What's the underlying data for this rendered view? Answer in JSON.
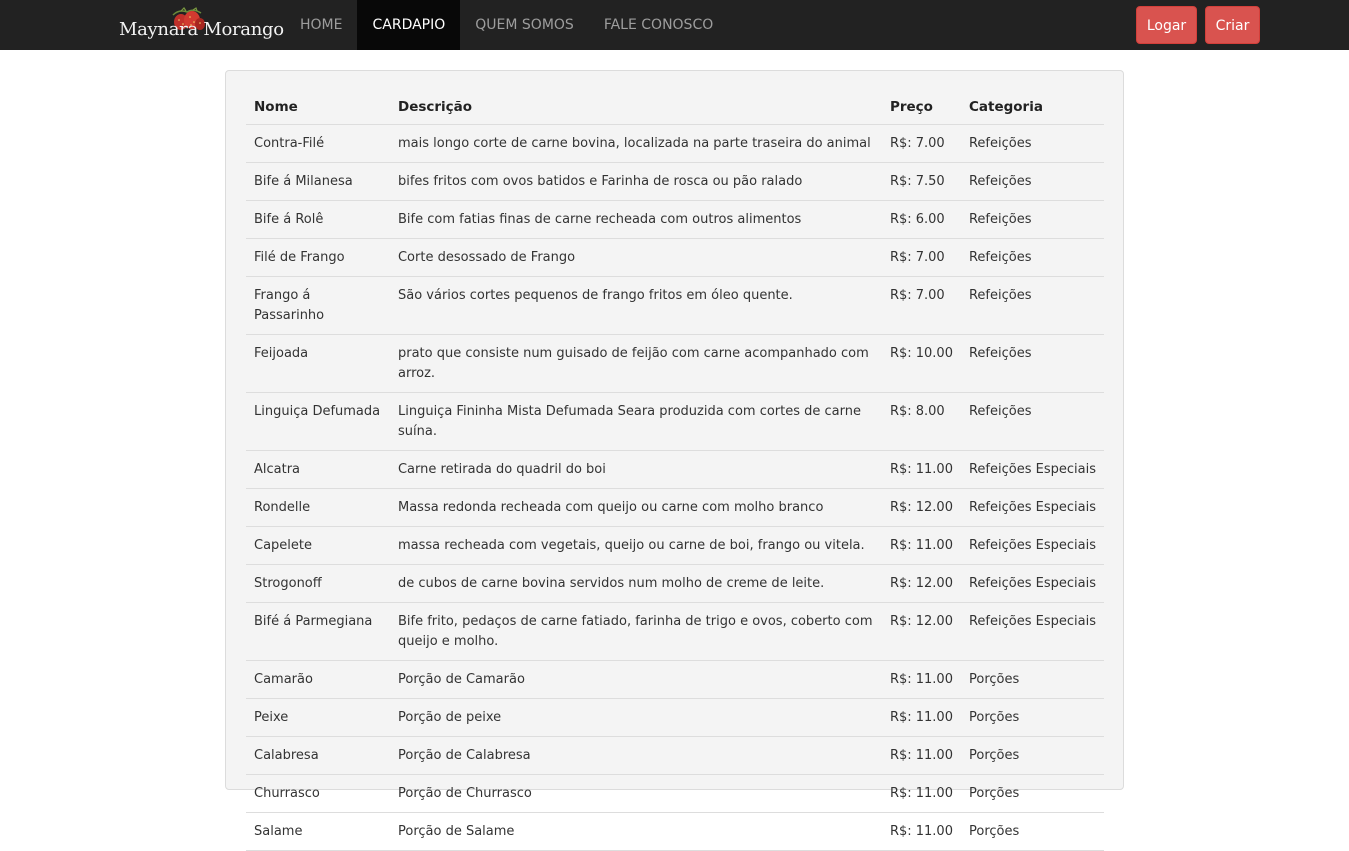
{
  "navbar": {
    "brand": "Maynara Morango",
    "brand_logo_icon": "strawberry-icon",
    "items": [
      {
        "label": "HOME",
        "active": false
      },
      {
        "label": "CARDAPIO",
        "active": true
      },
      {
        "label": "QUEM SOMOS",
        "active": false
      },
      {
        "label": "FALE CONOSCO",
        "active": false
      }
    ],
    "login_label": "Logar",
    "create_label": "Criar",
    "accent_color": "#d9534f"
  },
  "menu_table": {
    "headers": {
      "name": "Nome",
      "description": "Descrição",
      "price": "Preço",
      "category": "Categoria"
    },
    "rows": [
      {
        "name": "Contra-Filé",
        "description": "mais longo corte de carne bovina, localizada na parte traseira do animal",
        "price": "R$: 7.00",
        "category": "Refeições"
      },
      {
        "name": "Bife á Milanesa",
        "description": "bifes fritos com ovos batidos e Farinha de rosca ou pão ralado",
        "price": "R$: 7.50",
        "category": "Refeições"
      },
      {
        "name": "Bife á Rolê",
        "description": "Bife com fatias finas de carne recheada com outros alimentos",
        "price": "R$: 6.00",
        "category": "Refeições"
      },
      {
        "name": "Filé de Frango",
        "description": "Corte desossado de Frango",
        "price": "R$: 7.00",
        "category": "Refeições"
      },
      {
        "name": "Frango á Passarinho",
        "description": "São vários cortes pequenos de frango fritos em óleo quente.",
        "price": "R$: 7.00",
        "category": "Refeições"
      },
      {
        "name": "Feijoada",
        "description": "prato que consiste num guisado de feijão com carne acompanhado com arroz.",
        "price": "R$: 10.00",
        "category": "Refeições"
      },
      {
        "name": "Linguiça Defumada",
        "description": "Linguiça Fininha Mista Defumada Seara produzida com cortes de carne suína.",
        "price": "R$: 8.00",
        "category": "Refeições"
      },
      {
        "name": "Alcatra",
        "description": "Carne retirada do quadril do boi",
        "price": "R$: 11.00",
        "category": "Refeições Especiais"
      },
      {
        "name": "Rondelle",
        "description": "Massa redonda recheada com queijo ou carne com molho branco",
        "price": "R$: 12.00",
        "category": "Refeições Especiais"
      },
      {
        "name": "Capelete",
        "description": "massa recheada com vegetais, queijo ou carne de boi, frango ou vitela.",
        "price": "R$: 11.00",
        "category": "Refeições Especiais"
      },
      {
        "name": "Strogonoff",
        "description": "de cubos de carne bovina servidos num molho de creme de leite.",
        "price": "R$: 12.00",
        "category": "Refeições Especiais"
      },
      {
        "name": "Bifé á Parmegiana",
        "description": "Bife frito, pedaços de carne fatiado, farinha de trigo e ovos, coberto com queijo e molho.",
        "price": "R$: 12.00",
        "category": "Refeições Especiais"
      },
      {
        "name": "Camarão",
        "description": "Porção de Camarão",
        "price": "R$: 11.00",
        "category": "Porções"
      },
      {
        "name": "Peixe",
        "description": "Porção de peixe",
        "price": "R$: 11.00",
        "category": "Porções"
      },
      {
        "name": "Calabresa",
        "description": "Porção de Calabresa",
        "price": "R$: 11.00",
        "category": "Porções"
      },
      {
        "name": "Churrasco",
        "description": "Porção de Churrasco",
        "price": "R$: 11.00",
        "category": "Porções"
      },
      {
        "name": "Salame",
        "description": "Porção de Salame",
        "price": "R$: 11.00",
        "category": "Porções"
      }
    ]
  }
}
